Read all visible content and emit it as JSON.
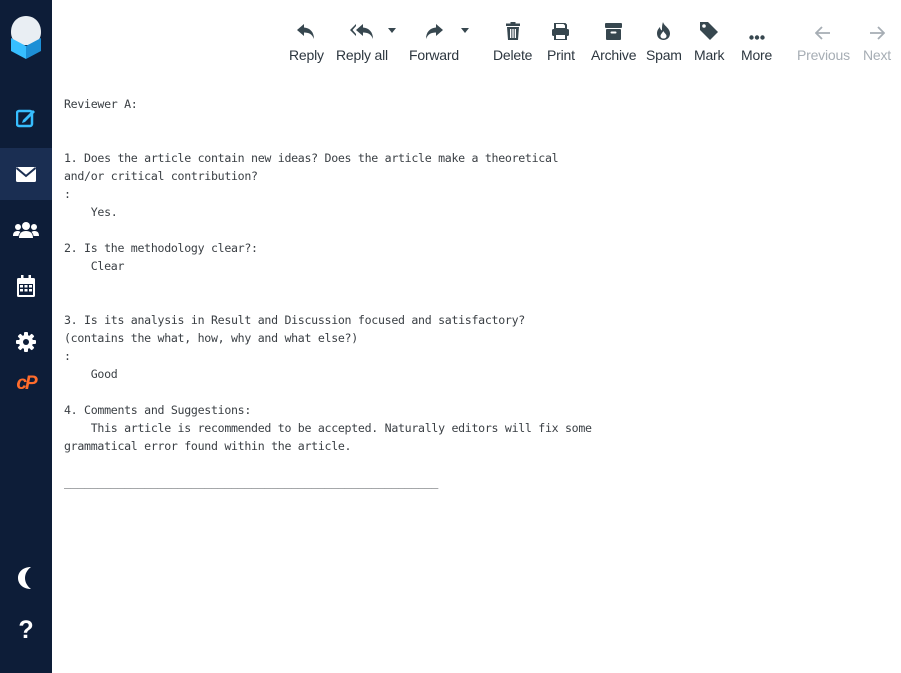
{
  "toolbar": {
    "reply": "Reply",
    "reply_all": "Reply all",
    "forward": "Forward",
    "delete": "Delete",
    "print": "Print",
    "archive": "Archive",
    "spam": "Spam",
    "mark": "Mark",
    "more": "More",
    "previous": "Previous",
    "next": "Next"
  },
  "colors": {
    "sidebar_bg": "#0d1d38",
    "sidebar_active": "#1a2e52",
    "accent_blue": "#37beff",
    "cpanel_orange": "#ff6c2c"
  },
  "sidebar": {
    "icons": [
      "logo-icon",
      "compose-icon",
      "mail-icon",
      "contacts-icon",
      "calendar-icon",
      "settings-icon",
      "cpanel-icon",
      "moon-icon",
      "help-icon"
    ],
    "cpanel_label": "cP",
    "help_label": "?"
  },
  "message": {
    "lines": [
      "Reviewer A:",
      "",
      "",
      "1. Does the article contain new ideas? Does the article make a theoretical",
      "and/or critical contribution?",
      ":",
      "    Yes.",
      "",
      "2. Is the methodology clear?:",
      "    Clear",
      "",
      "",
      "3. Is its analysis in Result and Discussion focused and satisfactory?",
      "(contains the what, how, why and what else?)",
      ":",
      "    Good",
      "",
      "4. Comments and Suggestions:",
      "    This article is recommended to be accepted. Naturally editors will fix some",
      "grammatical error found within the article.",
      "",
      "________________________________________________________"
    ]
  }
}
